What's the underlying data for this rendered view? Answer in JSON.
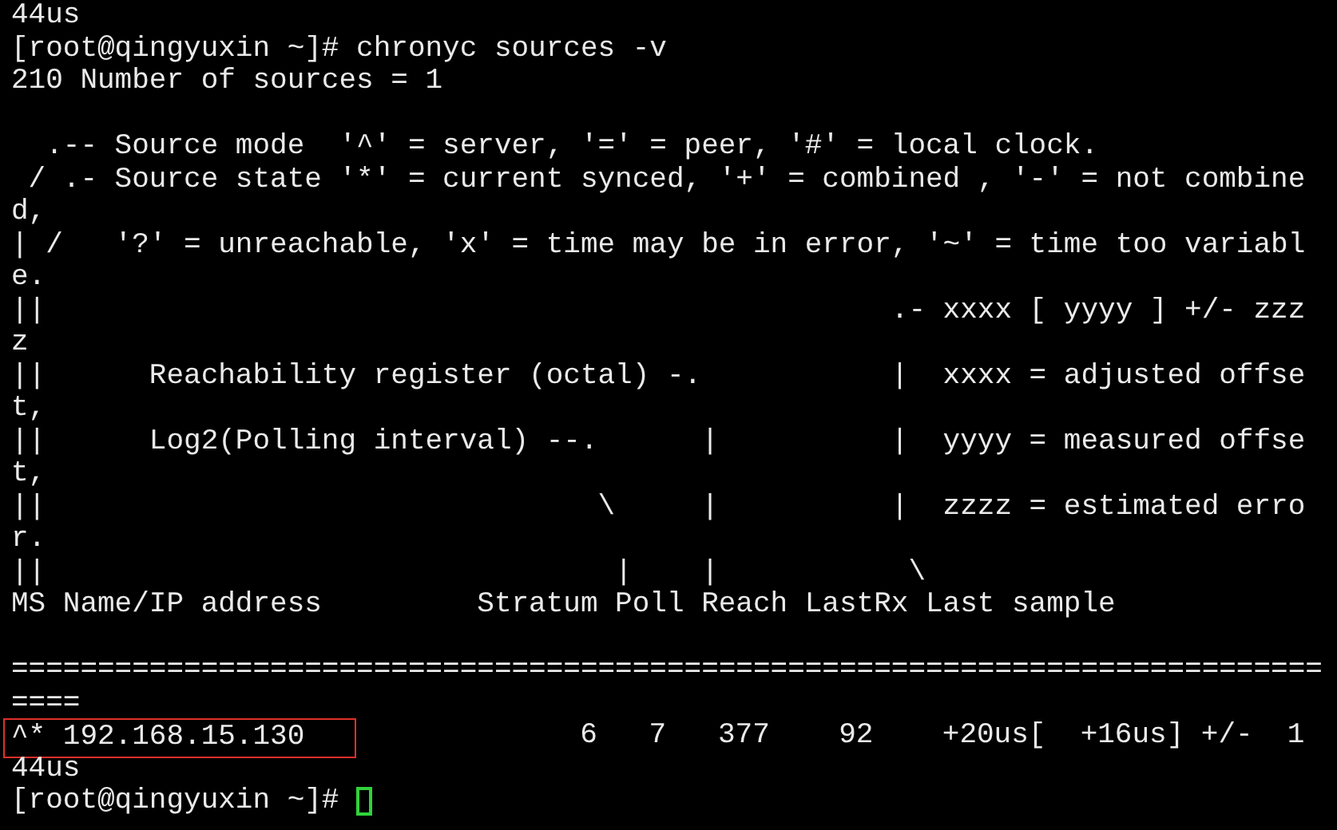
{
  "terminal": {
    "lines": [
      {
        "kind": "text",
        "text": "44us"
      },
      {
        "kind": "text",
        "text": "[root@qingyuxin ~]# chronyc sources -v"
      },
      {
        "kind": "text",
        "text": "210 Number of sources = 1"
      },
      {
        "kind": "blank"
      },
      {
        "kind": "text",
        "text": "  .-- Source mode  '^' = server, '=' = peer, '#' = local clock."
      },
      {
        "kind": "text",
        "text": " / .- Source state '*' = current synced, '+' = combined , '-' = not combine"
      },
      {
        "kind": "text",
        "text": "d,"
      },
      {
        "kind": "text",
        "text": "| /   '?' = unreachable, 'x' = time may be in error, '~' = time too variabl"
      },
      {
        "kind": "text",
        "text": "e."
      },
      {
        "kind": "text",
        "text": "||                                                 .- xxxx [ yyyy ] +/- zzz"
      },
      {
        "kind": "text",
        "text": "z"
      },
      {
        "kind": "text",
        "text": "||      Reachability register (octal) -.           |  xxxx = adjusted offse"
      },
      {
        "kind": "text",
        "text": "t,"
      },
      {
        "kind": "text",
        "text": "||      Log2(Polling interval) --.      |          |  yyyy = measured offse"
      },
      {
        "kind": "text",
        "text": "t,"
      },
      {
        "kind": "text",
        "text": "||                                \\     |          |  zzzz = estimated erro"
      },
      {
        "kind": "text",
        "text": "r."
      },
      {
        "kind": "text",
        "text": "||                                 |    |           \\"
      },
      {
        "kind": "text",
        "text": "MS Name/IP address         Stratum Poll Reach LastRx Last sample"
      },
      {
        "kind": "blank"
      },
      {
        "kind": "text",
        "text": "============================================================================"
      },
      {
        "kind": "text",
        "text": "===="
      },
      {
        "kind": "boxed",
        "boxed": "^* 192.168.15.130",
        "text": "             6   7   377    92    +20us[  +16us] +/-  1"
      },
      {
        "kind": "text",
        "text": "44us"
      },
      {
        "kind": "prompt",
        "text": "[root@qingyuxin ~]# "
      }
    ]
  }
}
